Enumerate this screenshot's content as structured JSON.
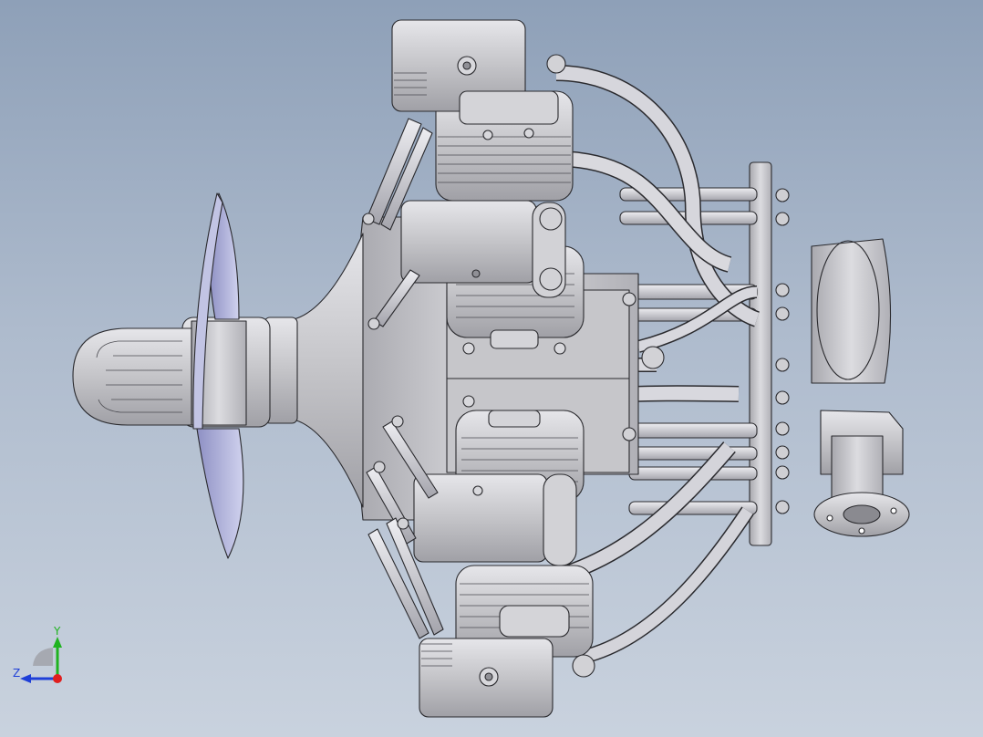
{
  "viewport": {
    "background_top": "#8ea0b8",
    "background_bottom": "#c9d2de",
    "model_fill": "#c8c8cc",
    "model_edge": "#2a2a2e",
    "propeller_fill": "#a6a8d0"
  },
  "triad": {
    "y_label": "Y",
    "z_label": "Z",
    "y_color": "#1fb31f",
    "z_color": "#1f3fd8",
    "x_color": "#e01f1f"
  }
}
